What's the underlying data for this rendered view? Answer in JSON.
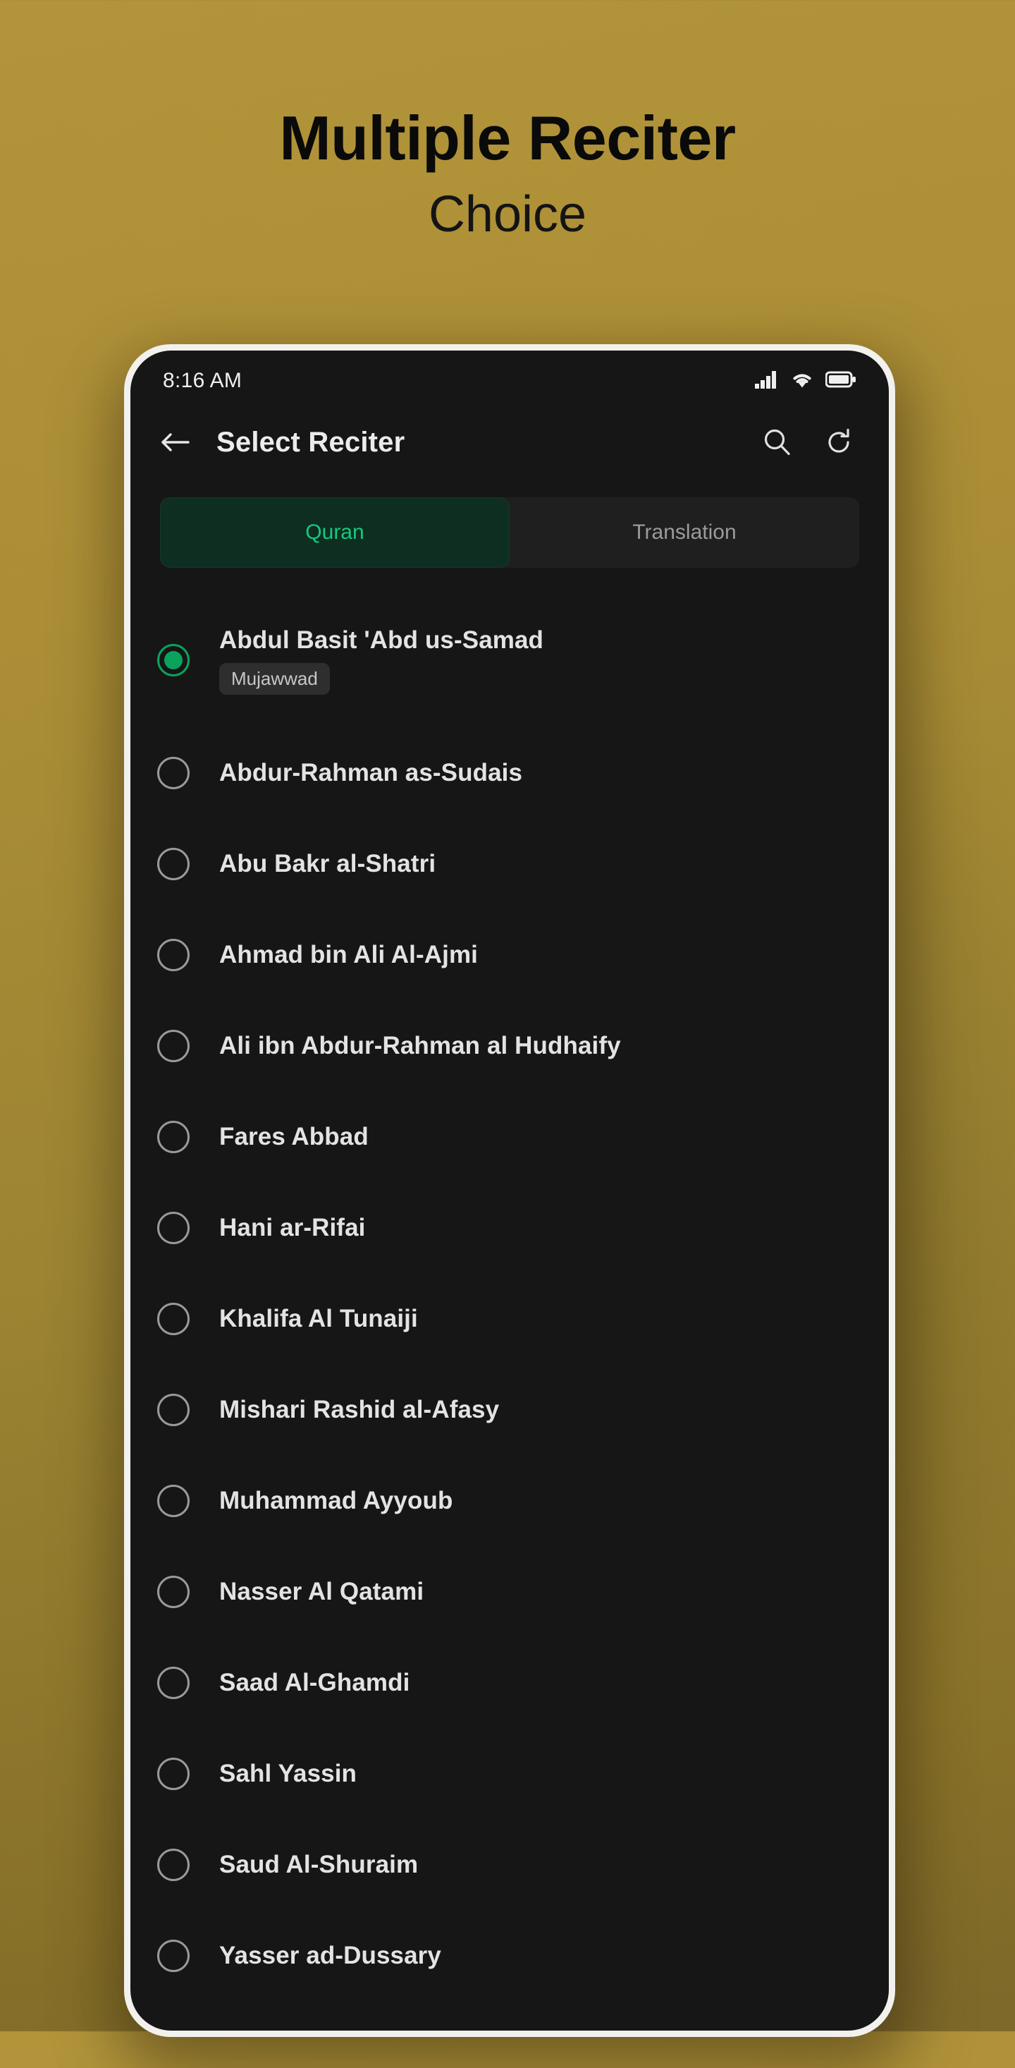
{
  "promo": {
    "title": "Multiple Reciter",
    "subtitle": "Choice",
    "bg_color_top": "#b2943a",
    "bg_color_bottom": "#7d682a",
    "text_color": "#0a0a0a"
  },
  "phone": {
    "bezel_color": "#f2f1ee",
    "screen_bg": "#161616"
  },
  "status_bar": {
    "time": "8:16 AM",
    "icons": [
      "signal-bars-icon",
      "wifi-icon",
      "battery-icon"
    ]
  },
  "app_bar": {
    "back_icon": "back-arrow-icon",
    "title": "Select Reciter",
    "actions": [
      {
        "icon": "search-icon",
        "label": "Search"
      },
      {
        "icon": "refresh-icon",
        "label": "Refresh"
      }
    ]
  },
  "tabs": {
    "active_index": 0,
    "active_color": "#15c97e",
    "active_bg": "#0e2e22",
    "items": [
      {
        "label": "Quran"
      },
      {
        "label": "Translation"
      }
    ]
  },
  "reciter_list": {
    "selected_index": 0,
    "accent_color": "#0aa35e",
    "items": [
      {
        "name": "Abdul Basit 'Abd us-Samad",
        "badge": "Mujawwad",
        "selected": true
      },
      {
        "name": "Abdur-Rahman as-Sudais",
        "badge": null,
        "selected": false
      },
      {
        "name": "Abu Bakr al-Shatri",
        "badge": null,
        "selected": false
      },
      {
        "name": "Ahmad bin Ali Al-Ajmi",
        "badge": null,
        "selected": false
      },
      {
        "name": "Ali ibn Abdur-Rahman al Hudhaify",
        "badge": null,
        "selected": false
      },
      {
        "name": "Fares Abbad",
        "badge": null,
        "selected": false
      },
      {
        "name": "Hani ar-Rifai",
        "badge": null,
        "selected": false
      },
      {
        "name": "Khalifa Al Tunaiji",
        "badge": null,
        "selected": false
      },
      {
        "name": "Mishari Rashid al-Afasy",
        "badge": null,
        "selected": false
      },
      {
        "name": "Muhammad Ayyoub",
        "badge": null,
        "selected": false
      },
      {
        "name": "Nasser Al Qatami",
        "badge": null,
        "selected": false
      },
      {
        "name": "Saad Al-Ghamdi",
        "badge": null,
        "selected": false
      },
      {
        "name": "Sahl Yassin",
        "badge": null,
        "selected": false
      },
      {
        "name": "Saud Al-Shuraim",
        "badge": null,
        "selected": false
      },
      {
        "name": "Yasser ad-Dussary",
        "badge": null,
        "selected": false
      }
    ]
  }
}
